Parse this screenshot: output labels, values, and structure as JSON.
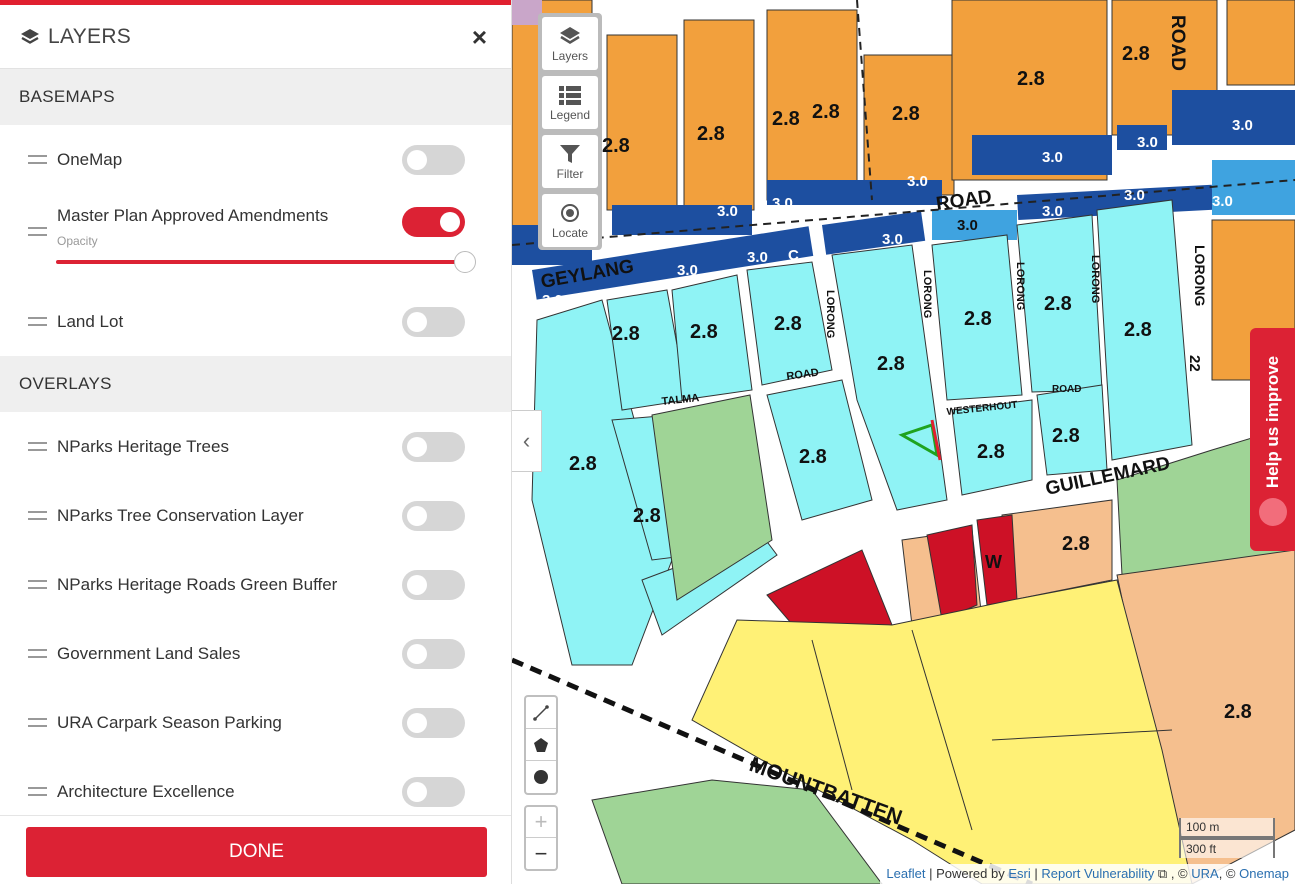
{
  "panel": {
    "title": "LAYERS",
    "close_label": "×",
    "basemaps_heading": "BASEMAPS",
    "overlays_heading": "OVERLAYS",
    "basemaps": [
      {
        "label": "OneMap",
        "on": false
      },
      {
        "label": "Master Plan Approved Amendments",
        "on": true,
        "opacity_label": "Opacity",
        "opacity": 1.0
      },
      {
        "label": "Land Lot",
        "on": false
      }
    ],
    "overlays": [
      {
        "label": "NParks Heritage Trees",
        "on": false
      },
      {
        "label": "NParks Tree Conservation Layer",
        "on": false
      },
      {
        "label": "NParks Heritage Roads Green Buffer",
        "on": false
      },
      {
        "label": "Government Land Sales",
        "on": false
      },
      {
        "label": "URA Carpark Season Parking",
        "on": false
      },
      {
        "label": "Architecture Excellence",
        "on": false
      }
    ],
    "done_label": "DONE"
  },
  "map": {
    "collapse_label": "‹",
    "toolbar": [
      {
        "label": "Layers",
        "icon": "layers-icon"
      },
      {
        "label": "Legend",
        "icon": "legend-icon"
      },
      {
        "label": "Filter",
        "icon": "filter-icon"
      },
      {
        "label": "Locate",
        "icon": "locate-icon"
      }
    ],
    "zoom_in": "+",
    "zoom_out": "−",
    "help_label": "Help us improve",
    "scale_m": "100 m",
    "scale_ft": "300 ft",
    "attribution": {
      "leaflet": "Leaflet",
      "powered": " | Powered by ",
      "esri": "Esri",
      "sep": " | ",
      "report": "Report Vulnerability",
      "ura_prefix": " , © ",
      "ura": "URA",
      "onemap_prefix": ", © ",
      "onemap": "Onemap"
    },
    "labels": {
      "roads": [
        "GEYLANG",
        "ROAD",
        "ROAD",
        "GUILLEMARD",
        "MOUNTBATTEN",
        "LORONG",
        "LORONG",
        "LORONG",
        "LORONG",
        "TALMA",
        "WESTERHOUT",
        "ROAD",
        "22"
      ],
      "plot_ratios": [
        "2.8",
        "3.0",
        "C",
        "W"
      ]
    },
    "colors": {
      "residential": "#8ff3f5",
      "commercial": "#f2a03d",
      "mixed": "#f5bf8e",
      "blue_plot": "#1d4fa0",
      "park": "#9fd496",
      "education": "#fff176",
      "place_of_worship": "#cd1126",
      "brand": "#dc2234"
    }
  }
}
